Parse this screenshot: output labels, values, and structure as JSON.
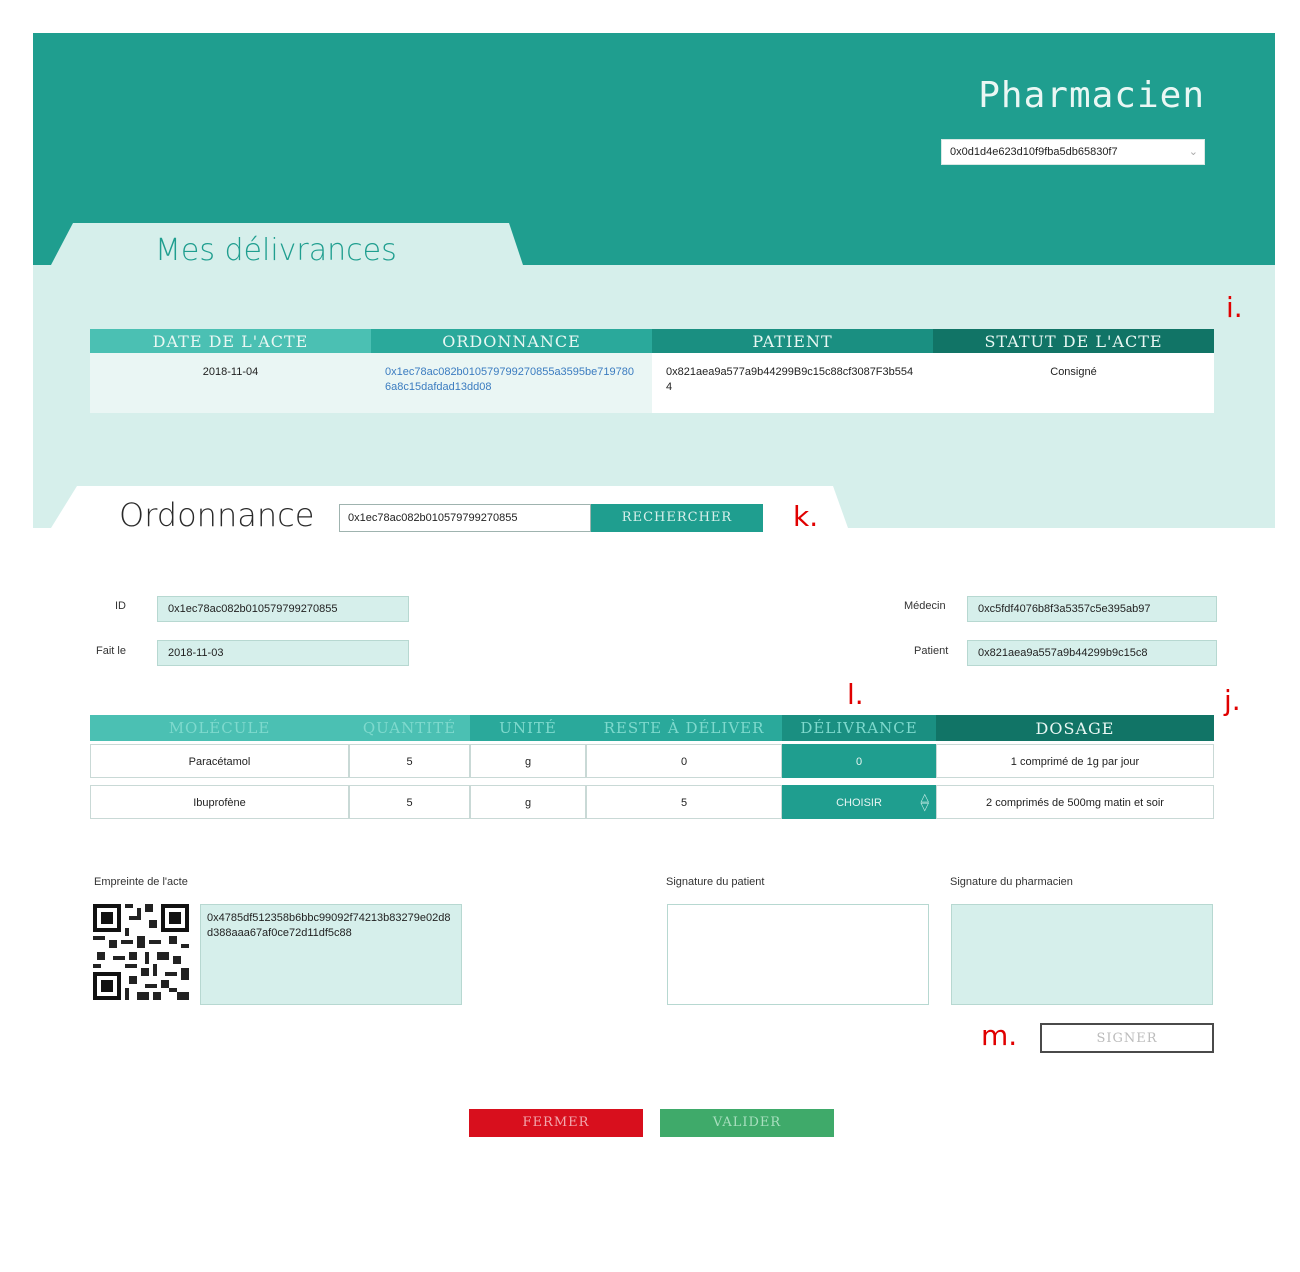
{
  "header": {
    "role_title": "Pharmacien",
    "account_address": "0x0d1d4e623d10f9fba5db65830f7"
  },
  "delivrances": {
    "tab_title": "Mes délivrances",
    "columns": [
      "DATE DE L'ACTE",
      "ORDONNANCE",
      "PATIENT",
      "STATUT DE L'ACTE"
    ],
    "rows": [
      {
        "date": "2018-11-04",
        "ordonnance": "0x1ec78ac082b010579799270855a3595be7197806a8c15dafdad13dd08",
        "patient": "0x821aea9a577a9b44299B9c15c88cf3087F3b5544",
        "statut": "Consigné"
      }
    ]
  },
  "ordonnance": {
    "tab_title": "Ordonnance",
    "search_value": "0x1ec78ac082b010579799270855",
    "search_button": "RECHERCHER",
    "id_label": "ID",
    "id_value": "0x1ec78ac082b010579799270855",
    "date_label": "Fait le",
    "date_value": "2018-11-03",
    "medecin_label": "Médecin",
    "medecin_value": "0xc5fdf4076b8f3a5357c5e395ab97",
    "patient_label": "Patient",
    "patient_value": "0x821aea9a557a9b44299b9c15c8"
  },
  "molecules": {
    "columns": [
      "MOLÉCULE",
      "QUANTITÉ",
      "UNITÉ",
      "RESTE À DÉLIVER",
      "DÉLIVRANCE",
      "DOSAGE"
    ],
    "rows": [
      {
        "molecule": "Paracétamol",
        "quantite": "5",
        "unite": "g",
        "reste": "0",
        "delivrance": "0",
        "dosage": "1 comprimé de 1g par jour"
      },
      {
        "molecule": "Ibuprofène",
        "quantite": "5",
        "unite": "g",
        "reste": "5",
        "delivrance": "CHOISIR",
        "dosage": "2 comprimés de 500mg matin et soir"
      }
    ]
  },
  "signatures": {
    "empreinte_label": "Empreinte de l'acte",
    "empreinte_value": "0x4785df512358b6bbc99092f74213b83279e02d8d388aaa67af0ce72d11df5c88",
    "patient_label": "Signature du patient",
    "pharmacien_label": "Signature du pharmacien",
    "sign_button": "SIGNER"
  },
  "footer": {
    "close_button": "FERMER",
    "validate_button": "VALIDER"
  },
  "annotations": {
    "i": "i.",
    "j": "j.",
    "k": "k.",
    "l": "l.",
    "m": "m."
  },
  "colors": {
    "teal": "#1f9e8f",
    "light_teal": "#d6efeb",
    "close_red": "#d80f1d",
    "validate_green": "#3faa6a",
    "annotation_red": "#e00000"
  }
}
